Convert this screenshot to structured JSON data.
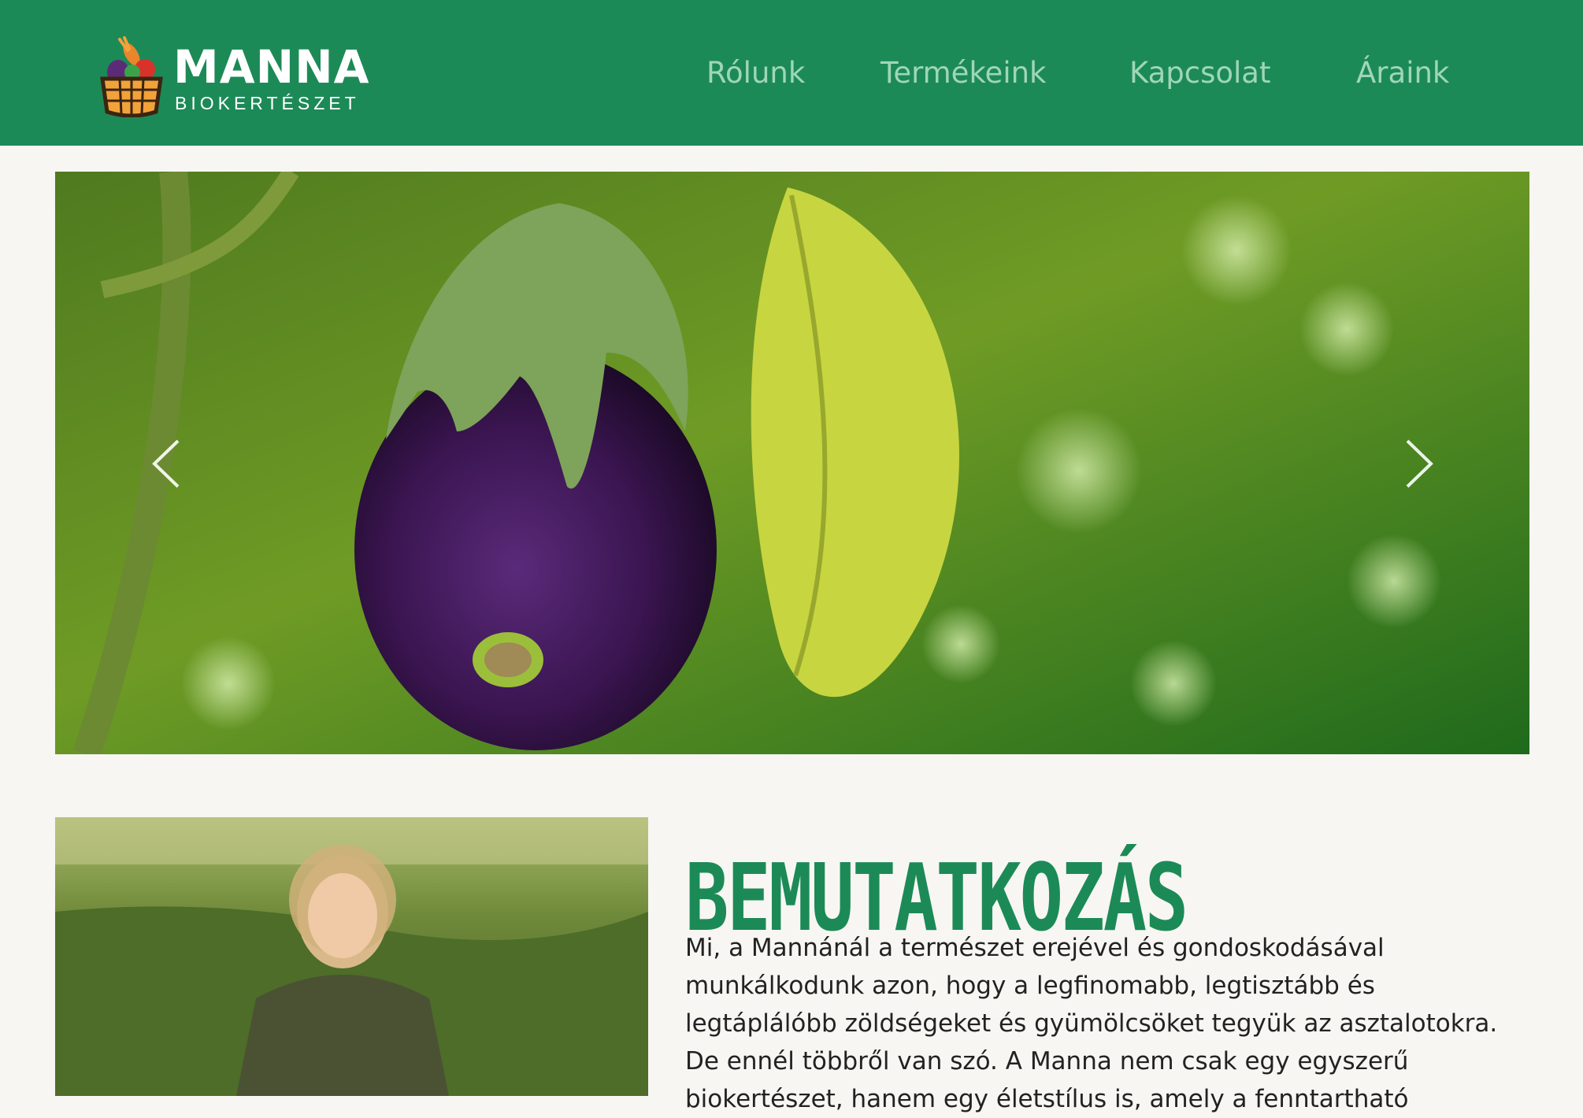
{
  "brand": {
    "name": "MANNA",
    "tagline": "BIOKERTÉSZET"
  },
  "nav": {
    "items": [
      "Rólunk",
      "Termékeink",
      "Kapcsolat",
      "Áraink"
    ]
  },
  "colors": {
    "header": "#1c8a57",
    "nav_text": "#9fd6ba",
    "accent": "#1c8a57",
    "background": "#f7f6f2"
  },
  "carousel": {
    "prev_icon": "chevron-left-icon",
    "next_icon": "chevron-right-icon"
  },
  "about": {
    "title": "BEMUTATKOZÁS",
    "paragraph": "Mi, a Mannánál a természet erejével és gondoskodásával munkálkodunk azon, hogy a legfinomabb, legtisztább és legtáplálóbb zöldségeket és gyümölcsöket tegyük az asztalotokra. De ennél többről van szó. A Manna nem csak egy egyszerű biokertészet, hanem egy életstílus is, amely a fenntartható"
  }
}
